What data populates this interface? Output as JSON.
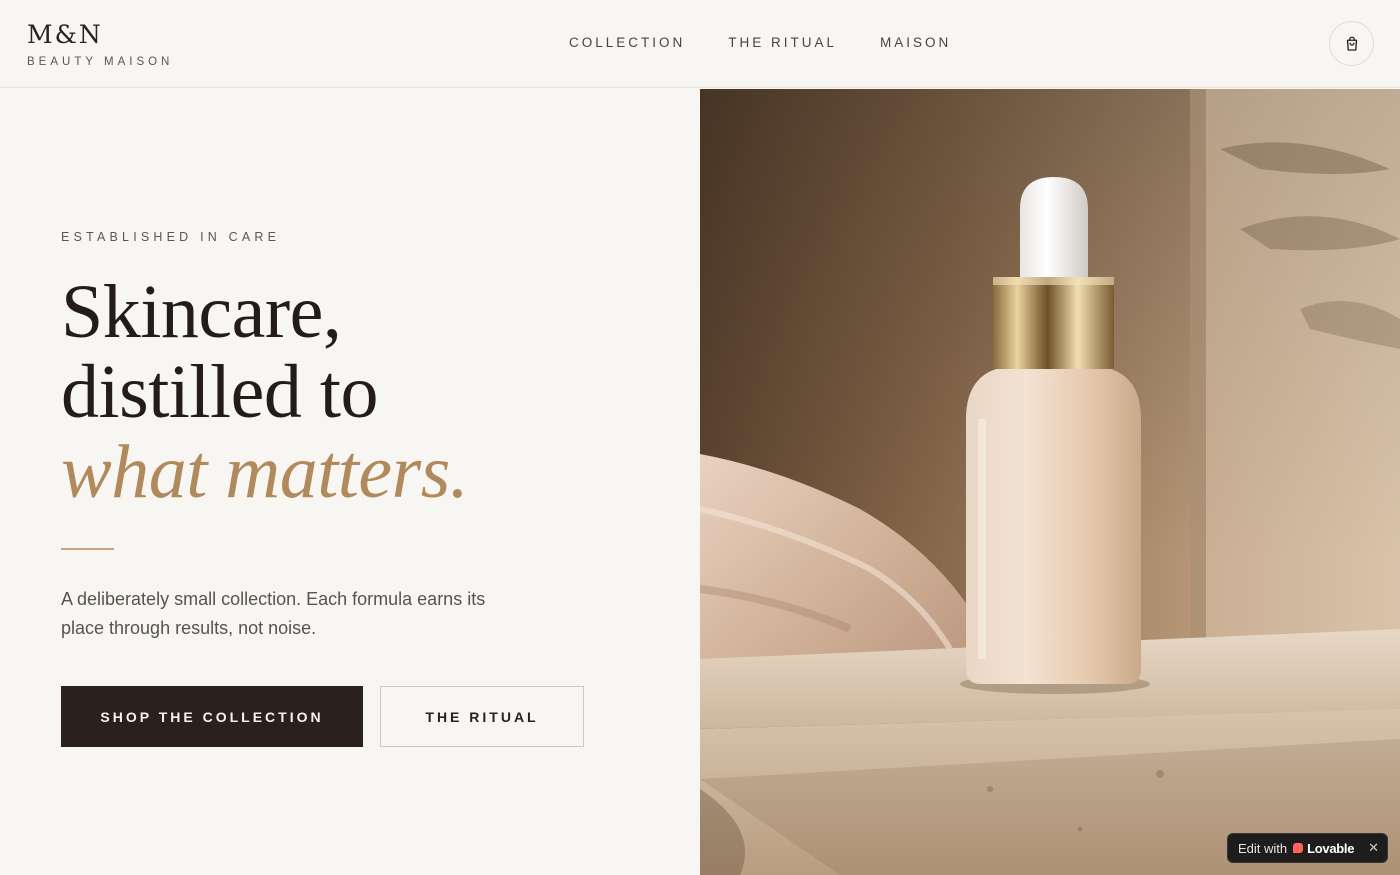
{
  "brand": {
    "mark": "M&N",
    "subtitle": "BEAUTY MAISON"
  },
  "nav": {
    "items": [
      {
        "label": "COLLECTION"
      },
      {
        "label": "THE RITUAL"
      },
      {
        "label": "MAISON"
      }
    ],
    "cart_icon": "shopping-bag-icon"
  },
  "hero": {
    "eyebrow": "ESTABLISHED IN CARE",
    "headline_line1": "Skincare,",
    "headline_line2": "distilled to",
    "headline_accent": "what matters.",
    "lead": "A deliberately small collection. Each formula earns its place through results, not noise.",
    "primary_cta": "SHOP THE COLLECTION",
    "secondary_cta": "THE RITUAL",
    "image_subject": "frosted serum dropper bottle with gold collar on stone ledge with silk drape"
  },
  "badge": {
    "prefix": "Edit with",
    "brand": "Lovable",
    "close": "✕"
  },
  "colors": {
    "background": "#f8f6f2",
    "ink": "#231c1a",
    "accent_gold": "#b08a5c",
    "button_dark": "#2a201c"
  }
}
